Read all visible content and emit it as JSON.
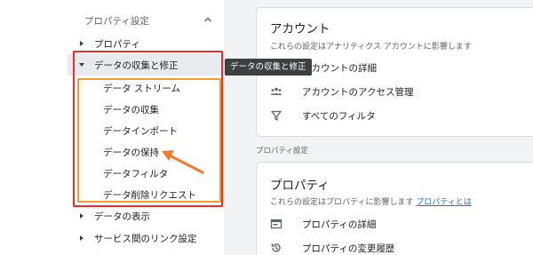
{
  "sidebar": {
    "header": "プロパティ設定",
    "items": [
      {
        "label": "プロパティ"
      },
      {
        "label": "データの収集と修正"
      },
      {
        "label": "データの表示"
      },
      {
        "label": "サービス間のリンク設定"
      }
    ],
    "subitems": [
      {
        "label": "データ ストリーム"
      },
      {
        "label": "データの収集"
      },
      {
        "label": "データインポート"
      },
      {
        "label": "データの保持"
      },
      {
        "label": "データフィルタ"
      },
      {
        "label": "データ削除リクエスト"
      }
    ]
  },
  "tooltip": "データの収集と修正",
  "account_card": {
    "title": "アカウント",
    "desc": "これらの設定はアナリティクス アカウントに影響します",
    "items": [
      {
        "label": "アカウントの詳細",
        "icon": "account-details-icon"
      },
      {
        "label": "アカウントのアクセス管理",
        "icon": "people-icon"
      },
      {
        "label": "すべてのフィルタ",
        "icon": "filter-icon"
      }
    ]
  },
  "section_label": "プロパティ設定",
  "property_card": {
    "title": "プロパティ",
    "desc": "これらの設定はプロパティに影響します",
    "link": "プロパティとは",
    "items": [
      {
        "label": "プロパティの詳細",
        "icon": "property-details-icon"
      },
      {
        "label": "プロパティの変更履歴",
        "icon": "history-icon"
      }
    ]
  },
  "colors": {
    "highlight_red": "#e8312f",
    "highlight_orange": "#f39b2f",
    "link": "#1a73e8"
  }
}
